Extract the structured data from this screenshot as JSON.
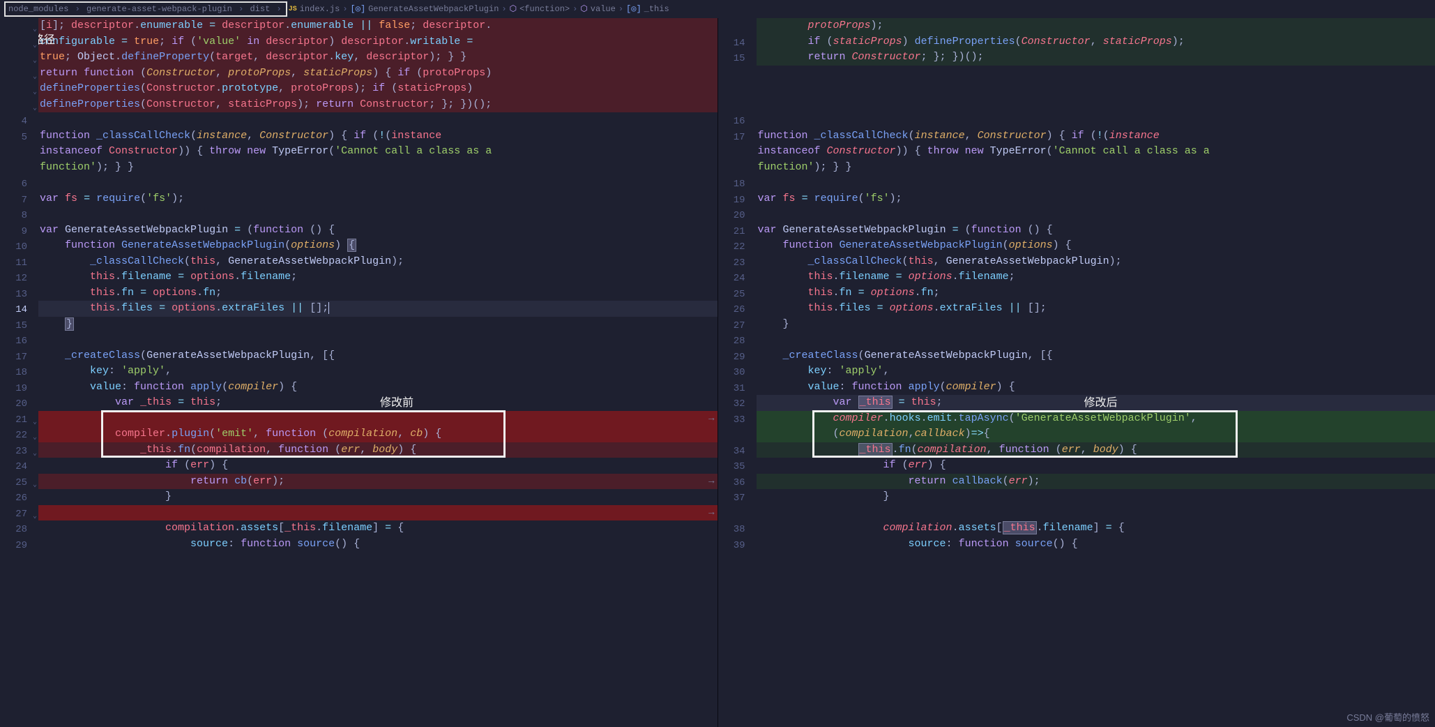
{
  "breadcrumb": {
    "parts": [
      "node_modules",
      "generate-asset-webpack-plugin",
      "dist",
      "index.js",
      "GenerateAssetWebpackPlugin",
      "<function>",
      "value",
      "_this"
    ],
    "file_icon": "JS",
    "class_icon": "◉",
    "fn_icon": "⬡",
    "var_icon": "[◎]"
  },
  "annotations": {
    "file_path_label": "文件路径",
    "before_label": "修改前",
    "after_label": "修改后",
    "watermark": "CSDN @葡萄的愤怒"
  },
  "left": {
    "lines": [
      {
        "n": "",
        "fold": "-",
        "cls": "diff-del",
        "html": "<span class='tk-pn'>[</span><span class='tk-var'>i</span><span class='tk-pn'>]; </span><span class='tk-var'>descriptor</span><span class='tk-pn'>.</span><span class='tk-prop'>enumerable</span> <span class='tk-op'>=</span> <span class='tk-var'>descriptor</span><span class='tk-pn'>.</span><span class='tk-prop'>enumerable</span> <span class='tk-op'>||</span> <span class='tk-bool'>false</span><span class='tk-pn'>; </span><span class='tk-var'>descriptor</span><span class='tk-pn'>.</span>"
      },
      {
        "n": "",
        "fold": "-",
        "cls": "diff-del",
        "html": "<span class='tk-prop'>configurable</span> <span class='tk-op'>=</span> <span class='tk-bool'>true</span><span class='tk-pn'>; </span><span class='tk-kw'>if</span> <span class='tk-pn'>(</span><span class='tk-str'>'value'</span> <span class='tk-kw'>in</span> <span class='tk-var'>descriptor</span><span class='tk-pn'>) </span><span class='tk-var'>descriptor</span><span class='tk-pn'>.</span><span class='tk-prop'>writable</span> <span class='tk-op'>=</span>"
      },
      {
        "n": "",
        "fold": "-",
        "cls": "diff-del",
        "html": "<span class='tk-bool'>true</span><span class='tk-pn'>; </span><span class='tk-cls'>Object</span><span class='tk-pn'>.</span><span class='tk-fn'>defineProperty</span><span class='tk-pn'>(</span><span class='tk-var'>target</span><span class='tk-pn'>, </span><span class='tk-var'>descriptor</span><span class='tk-pn'>.</span><span class='tk-prop'>key</span><span class='tk-pn'>, </span><span class='tk-var'>descriptor</span><span class='tk-pn'>); } }</span>"
      },
      {
        "n": "",
        "fold": "-",
        "cls": "diff-del",
        "html": "<span class='tk-kw'>return</span> <span class='tk-kw'>function</span> <span class='tk-pn'>(</span><span class='tk-param'>Constructor</span><span class='tk-pn'>, </span><span class='tk-param'>protoProps</span><span class='tk-pn'>, </span><span class='tk-param'>staticProps</span><span class='tk-pn'>) { </span><span class='tk-kw'>if</span> <span class='tk-pn'>(</span><span class='tk-var'>protoProps</span><span class='tk-pn'>)</span>"
      },
      {
        "n": "",
        "fold": "-",
        "cls": "diff-del",
        "html": "<span class='tk-fn'>defineProperties</span><span class='tk-pn'>(</span><span class='tk-var'>Constructor</span><span class='tk-pn'>.</span><span class='tk-prop'>prototype</span><span class='tk-pn'>, </span><span class='tk-var'>protoProps</span><span class='tk-pn'>); </span><span class='tk-kw'>if</span> <span class='tk-pn'>(</span><span class='tk-var'>staticProps</span><span class='tk-pn'>)</span>"
      },
      {
        "n": "",
        "fold": "-",
        "cls": "diff-del",
        "html": "<span class='tk-fn'>defineProperties</span><span class='tk-pn'>(</span><span class='tk-var'>Constructor</span><span class='tk-pn'>, </span><span class='tk-var'>staticProps</span><span class='tk-pn'>); </span><span class='tk-kw'>return</span> <span class='tk-var'>Constructor</span><span class='tk-pn'>; }; })();</span>"
      },
      {
        "n": "4",
        "html": ""
      },
      {
        "n": "5",
        "html": "<span class='tk-kw'>function</span> <span class='tk-fn'>_classCallCheck</span><span class='tk-pn'>(</span><span class='tk-param'>instance</span><span class='tk-pn'>, </span><span class='tk-param'>Constructor</span><span class='tk-pn'>) { </span><span class='tk-kw'>if</span> <span class='tk-pn'>(</span><span class='tk-op'>!</span><span class='tk-pn'>(</span><span class='tk-var'>instance</span>"
      },
      {
        "n": "",
        "html": "<span class='tk-kw'>instanceof</span> <span class='tk-var'>Constructor</span><span class='tk-pn'>)) { </span><span class='tk-kw'>throw</span> <span class='tk-kw'>new</span> <span class='tk-cls'>TypeError</span><span class='tk-pn'>(</span><span class='tk-str'>'Cannot call a class as a </span>"
      },
      {
        "n": "",
        "html": "<span class='tk-str'>function'</span><span class='tk-pn'>); } }</span>"
      },
      {
        "n": "6",
        "html": ""
      },
      {
        "n": "7",
        "html": "<span class='tk-kw'>var</span> <span class='tk-var'>fs</span> <span class='tk-op'>=</span> <span class='tk-fn'>require</span><span class='tk-pn'>(</span><span class='tk-str'>'fs'</span><span class='tk-pn'>);</span>"
      },
      {
        "n": "8",
        "html": ""
      },
      {
        "n": "9",
        "html": "<span class='tk-kw'>var</span> <span class='tk-cls'>GenerateAssetWebpackPlugin</span> <span class='tk-op'>=</span> <span class='tk-pn'>(</span><span class='tk-kw'>function</span> <span class='tk-pn'>() {</span>"
      },
      {
        "n": "10",
        "html": "    <span class='tk-kw'>function</span> <span class='tk-fn'>GenerateAssetWebpackPlugin</span><span class='tk-pn'>(</span><span class='tk-param'>options</span><span class='tk-pn'>) </span><span class='tk-pn hl-box'>{</span>"
      },
      {
        "n": "11",
        "html": "        <span class='tk-fn'>_classCallCheck</span><span class='tk-pn'>(</span><span class='tk-this'>this</span><span class='tk-pn'>, </span><span class='tk-cls'>GenerateAssetWebpackPlugin</span><span class='tk-pn'>);</span>"
      },
      {
        "n": "12",
        "html": "        <span class='tk-this'>this</span><span class='tk-pn'>.</span><span class='tk-prop'>filename</span> <span class='tk-op'>=</span> <span class='tk-var'>options</span><span class='tk-pn'>.</span><span class='tk-prop'>filename</span><span class='tk-pn'>;</span>"
      },
      {
        "n": "13",
        "html": "        <span class='tk-this'>this</span><span class='tk-pn'>.</span><span class='tk-prop'>fn</span> <span class='tk-op'>=</span> <span class='tk-var'>options</span><span class='tk-pn'>.</span><span class='tk-prop'>fn</span><span class='tk-pn'>;</span>"
      },
      {
        "n": "14",
        "active": true,
        "cls": "current",
        "html": "        <span class='tk-this'>this</span><span class='tk-pn'>.</span><span class='tk-prop'>files</span> <span class='tk-op'>=</span> <span class='tk-var'>options</span><span class='tk-pn'>.</span><span class='tk-prop'>extraFiles</span> <span class='tk-op'>||</span> <span class='tk-pn'>[];</span><span style='border-left:1px solid #c0caf5'></span>"
      },
      {
        "n": "15",
        "html": "    <span class='tk-pn hl-box'>}</span>"
      },
      {
        "n": "16",
        "html": ""
      },
      {
        "n": "17",
        "html": "    <span class='tk-fn'>_createClass</span><span class='tk-pn'>(</span><span class='tk-cls'>GenerateAssetWebpackPlugin</span><span class='tk-pn'>, [{</span>"
      },
      {
        "n": "18",
        "html": "        <span class='tk-prop'>key</span><span class='tk-pn'>: </span><span class='tk-str'>'apply'</span><span class='tk-pn'>,</span>"
      },
      {
        "n": "19",
        "html": "        <span class='tk-prop'>value</span><span class='tk-pn'>: </span><span class='tk-kw'>function</span> <span class='tk-fn'>apply</span><span class='tk-pn'>(</span><span class='tk-param'>compiler</span><span class='tk-pn'>) {</span>"
      },
      {
        "n": "20",
        "html": "            <span class='tk-kw'>var</span> <span class='tk-var'>_this</span> <span class='tk-op'>=</span> <span class='tk-this'>this</span><span class='tk-pn'>;</span>"
      },
      {
        "n": "21",
        "fold": "-",
        "cls": "diff-del-strong",
        "html": "",
        "arrow": true
      },
      {
        "n": "22",
        "fold": "-",
        "cls": "diff-del-strong",
        "html": "            <span class='tk-var'>compiler</span><span class='tk-pn'>.</span><span class='tk-fn'>plugin</span><span class='tk-pn'>(</span><span class='tk-str'>'emit'</span><span class='tk-pn'>, </span><span class='tk-kw'>function</span> <span class='tk-pn'>(</span><span class='tk-param'>compilation</span><span class='tk-pn'>, </span><span class='tk-param'>cb</span><span class='tk-pn'>) {</span>"
      },
      {
        "n": "23",
        "fold": "-",
        "cls": "diff-del",
        "html": "                <span class='tk-var'>_this</span><span class='tk-pn'>.</span><span class='tk-fn'>fn</span><span class='tk-pn'>(</span><span class='tk-var'>compilation</span><span class='tk-pn'>, </span><span class='tk-kw'>function</span> <span class='tk-pn'>(</span><span class='tk-param'>err</span><span class='tk-pn'>, </span><span class='tk-param'>body</span><span class='tk-pn'>) {</span>"
      },
      {
        "n": "24",
        "html": "                    <span class='tk-kw'>if</span> <span class='tk-pn'>(</span><span class='tk-var'>err</span><span class='tk-pn'>) {</span>"
      },
      {
        "n": "25",
        "fold": "-",
        "cls": "diff-del",
        "html": "                        <span class='tk-kw'>return</span> <span class='tk-fn'>cb</span><span class='tk-pn'>(</span><span class='tk-var'>err</span><span class='tk-pn'>);</span>",
        "arrow": true
      },
      {
        "n": "26",
        "html": "                    <span class='tk-pn'>}</span>"
      },
      {
        "n": "27",
        "fold": "-",
        "cls": "diff-del-strong",
        "html": "",
        "arrow": true
      },
      {
        "n": "28",
        "html": "                    <span class='tk-var'>compilation</span><span class='tk-pn'>.</span><span class='tk-prop'>assets</span><span class='tk-pn'>[</span><span class='tk-var'>_this</span><span class='tk-pn'>.</span><span class='tk-prop'>filename</span><span class='tk-pn'>] </span><span class='tk-op'>=</span> <span class='tk-pn'>{</span>"
      },
      {
        "n": "29",
        "html": "                        <span class='tk-prop'>source</span><span class='tk-pn'>: </span><span class='tk-kw'>function</span> <span class='tk-fn'>source</span><span class='tk-pn'>() {</span>"
      }
    ]
  },
  "right": {
    "lines": [
      {
        "n": "",
        "add": "+",
        "cls": "diff-add",
        "html": "        <span class='tk-var tk-it'>protoProps</span><span class='tk-pn'>);</span>"
      },
      {
        "n": "14",
        "add": "+",
        "cls": "diff-add",
        "html": "        <span class='tk-kw'>if</span> <span class='tk-pn'>(</span><span class='tk-var tk-it'>staticProps</span><span class='tk-pn'>) </span><span class='tk-fn'>defineProperties</span><span class='tk-pn'>(</span><span class='tk-var tk-it'>Constructor</span><span class='tk-pn'>, </span><span class='tk-var tk-it'>staticProps</span><span class='tk-pn'>);</span>"
      },
      {
        "n": "15",
        "add": "+",
        "cls": "diff-add",
        "html": "        <span class='tk-kw'>return</span> <span class='tk-var tk-it'>Constructor</span><span class='tk-pn'>; }; })();</span>"
      },
      {
        "n": "",
        "html": ""
      },
      {
        "n": "",
        "html": ""
      },
      {
        "n": "",
        "html": ""
      },
      {
        "n": "16",
        "html": ""
      },
      {
        "n": "17",
        "html": "<span class='tk-kw'>function</span> <span class='tk-fn'>_classCallCheck</span><span class='tk-pn'>(</span><span class='tk-param'>instance</span><span class='tk-pn'>, </span><span class='tk-param'>Constructor</span><span class='tk-pn'>) { </span><span class='tk-kw'>if</span> <span class='tk-pn'>(</span><span class='tk-op'>!</span><span class='tk-pn'>(</span><span class='tk-var tk-it'>instance</span>"
      },
      {
        "n": "",
        "html": "<span class='tk-kw'>instanceof</span> <span class='tk-var tk-it'>Constructor</span><span class='tk-pn'>)) { </span><span class='tk-kw'>throw</span> <span class='tk-kw'>new</span> <span class='tk-cls'>TypeError</span><span class='tk-pn'>(</span><span class='tk-str'>'Cannot call a class as a </span>"
      },
      {
        "n": "",
        "html": "<span class='tk-str'>function'</span><span class='tk-pn'>); } }</span>"
      },
      {
        "n": "18",
        "html": ""
      },
      {
        "n": "19",
        "html": "<span class='tk-kw'>var</span> <span class='tk-var'>fs</span> <span class='tk-op'>=</span> <span class='tk-fn'>require</span><span class='tk-pn'>(</span><span class='tk-str'>'fs'</span><span class='tk-pn'>);</span>"
      },
      {
        "n": "20",
        "html": ""
      },
      {
        "n": "21",
        "html": "<span class='tk-kw'>var</span> <span class='tk-cls'>GenerateAssetWebpackPlugin</span> <span class='tk-op'>=</span> <span class='tk-pn'>(</span><span class='tk-kw'>function</span> <span class='tk-pn'>() {</span>"
      },
      {
        "n": "22",
        "html": "    <span class='tk-kw'>function</span> <span class='tk-fn'>GenerateAssetWebpackPlugin</span><span class='tk-pn'>(</span><span class='tk-param'>options</span><span class='tk-pn'>) {</span>"
      },
      {
        "n": "23",
        "html": "        <span class='tk-fn'>_classCallCheck</span><span class='tk-pn'>(</span><span class='tk-this'>this</span><span class='tk-pn'>, </span><span class='tk-cls'>GenerateAssetWebpackPlugin</span><span class='tk-pn'>);</span>"
      },
      {
        "n": "24",
        "html": "        <span class='tk-this'>this</span><span class='tk-pn'>.</span><span class='tk-prop'>filename</span> <span class='tk-op'>=</span> <span class='tk-var tk-it'>options</span><span class='tk-pn'>.</span><span class='tk-prop'>filename</span><span class='tk-pn'>;</span>"
      },
      {
        "n": "25",
        "html": "        <span class='tk-this'>this</span><span class='tk-pn'>.</span><span class='tk-prop'>fn</span> <span class='tk-op'>=</span> <span class='tk-var tk-it'>options</span><span class='tk-pn'>.</span><span class='tk-prop'>fn</span><span class='tk-pn'>;</span>"
      },
      {
        "n": "26",
        "html": "        <span class='tk-this'>this</span><span class='tk-pn'>.</span><span class='tk-prop'>files</span> <span class='tk-op'>=</span> <span class='tk-var tk-it'>options</span><span class='tk-pn'>.</span><span class='tk-prop'>extraFiles</span> <span class='tk-op'>||</span> <span class='tk-pn'>[];</span>"
      },
      {
        "n": "27",
        "html": "    <span class='tk-pn'>}</span>"
      },
      {
        "n": "28",
        "html": ""
      },
      {
        "n": "29",
        "html": "    <span class='tk-fn'>_createClass</span><span class='tk-pn'>(</span><span class='tk-cls'>GenerateAssetWebpackPlugin</span><span class='tk-pn'>, [{</span>"
      },
      {
        "n": "30",
        "html": "        <span class='tk-prop'>key</span><span class='tk-pn'>: </span><span class='tk-str'>'apply'</span><span class='tk-pn'>,</span>"
      },
      {
        "n": "31",
        "html": "        <span class='tk-prop'>value</span><span class='tk-pn'>: </span><span class='tk-kw'>function</span> <span class='tk-fn'>apply</span><span class='tk-pn'>(</span><span class='tk-param'>compiler</span><span class='tk-pn'>) {</span>"
      },
      {
        "n": "32",
        "cls": "current",
        "html": "            <span class='tk-kw'>var</span> <span class='tk-var hl-box'>_this</span> <span class='tk-op'>=</span> <span class='tk-this'>this</span><span class='tk-pn'>;</span>"
      },
      {
        "n": "33",
        "add": "+",
        "cls": "diff-add-strong",
        "html": "            <span class='tk-var tk-it'>compiler</span><span class='tk-pn'>.</span><span class='tk-prop'>hooks</span><span class='tk-pn'>.</span><span class='tk-prop'>emit</span><span class='tk-pn'>.</span><span class='tk-fn'>tapAsync</span><span class='tk-pn'>(</span><span class='tk-str'>'GenerateAssetWebpackPlugin'</span><span class='tk-pn'>,</span>"
      },
      {
        "n": "",
        "add": "+",
        "cls": "diff-add-strong",
        "html": "            <span class='tk-pn'>(</span><span class='tk-param'>compilation</span><span class='tk-pn'>,</span><span class='tk-param'>callback</span><span class='tk-pn'>)</span><span class='tk-op'>=></span><span class='tk-pn'>{</span>"
      },
      {
        "n": "34",
        "add": "+",
        "cls": "diff-add",
        "html": "                <span class='tk-var hl-box'>_this</span><span class='tk-pn'>.</span><span class='tk-fn'>fn</span><span class='tk-pn'>(</span><span class='tk-var tk-it'>compilation</span><span class='tk-pn'>, </span><span class='tk-kw'>function</span> <span class='tk-pn'>(</span><span class='tk-param'>err</span><span class='tk-pn'>, </span><span class='tk-param'>body</span><span class='tk-pn'>) {</span>"
      },
      {
        "n": "35",
        "html": "                    <span class='tk-kw'>if</span> <span class='tk-pn'>(</span><span class='tk-var tk-it'>err</span><span class='tk-pn'>) {</span>"
      },
      {
        "n": "36",
        "add": "+",
        "cls": "diff-add",
        "html": "                        <span class='tk-kw'>return</span> <span class='tk-fn'>callback</span><span class='tk-pn'>(</span><span class='tk-var tk-it'>err</span><span class='tk-pn'>);</span>"
      },
      {
        "n": "37",
        "html": "                    <span class='tk-pn'>}</span>"
      },
      {
        "n": "",
        "html": ""
      },
      {
        "n": "38",
        "html": "                    <span class='tk-var tk-it'>compilation</span><span class='tk-pn'>.</span><span class='tk-prop'>assets</span><span class='tk-pn'>[</span><span class='tk-var hl-box'>_this</span><span class='tk-pn'>.</span><span class='tk-prop'>filename</span><span class='tk-pn'>] </span><span class='tk-op'>=</span> <span class='tk-pn'>{</span>"
      },
      {
        "n": "39",
        "html": "                        <span class='tk-prop'>source</span><span class='tk-pn'>: </span><span class='tk-kw'>function</span> <span class='tk-fn'>source</span><span class='tk-pn'>() {</span>"
      }
    ]
  }
}
